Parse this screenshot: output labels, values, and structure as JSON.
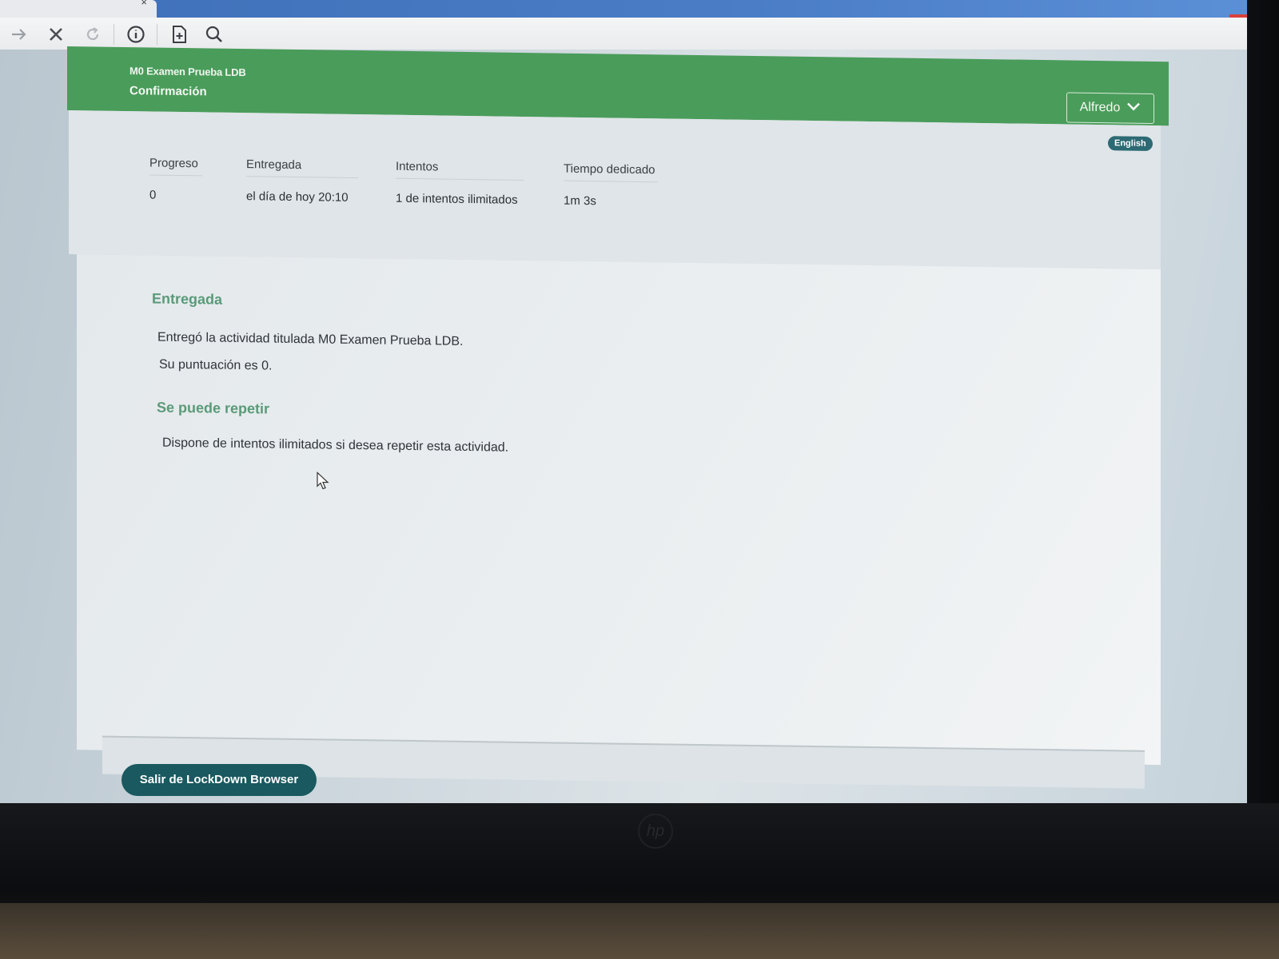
{
  "browser": {
    "tab_close": "×",
    "window_close": "×",
    "toolbar": {
      "forward_icon": "arrow-right-icon",
      "stop_icon": "close-icon",
      "reload_icon": "reload-icon",
      "info_icon": "info-icon",
      "page_icon": "add-page-icon",
      "search_icon": "search-icon"
    }
  },
  "header": {
    "course": "M0 Examen Prueba LDB",
    "title": "Confirmación",
    "user": "Alfredo",
    "accent": "#4a9c5a"
  },
  "language": {
    "label": "English"
  },
  "stats": [
    {
      "label": "Progreso",
      "value": "0"
    },
    {
      "label": "Entregada",
      "value": "el día de hoy 20:10"
    },
    {
      "label": "Intentos",
      "value": "1 de intentos ilimitados"
    },
    {
      "label": "Tiempo dedicado",
      "value": "1m 3s"
    }
  ],
  "content": {
    "submitted_heading": "Entregada",
    "submitted_line1": "Entregó la actividad titulada M0 Examen Prueba LDB.",
    "submitted_line2": "Su puntuación es 0.",
    "repeat_heading": "Se puede repetir",
    "repeat_line": "Dispone de intentos ilimitados si desea repetir esta actividad."
  },
  "footer": {
    "exit_button": "Salir de LockDown Browser",
    "exit_color": "#19595f"
  },
  "device": {
    "logo": "hp"
  }
}
